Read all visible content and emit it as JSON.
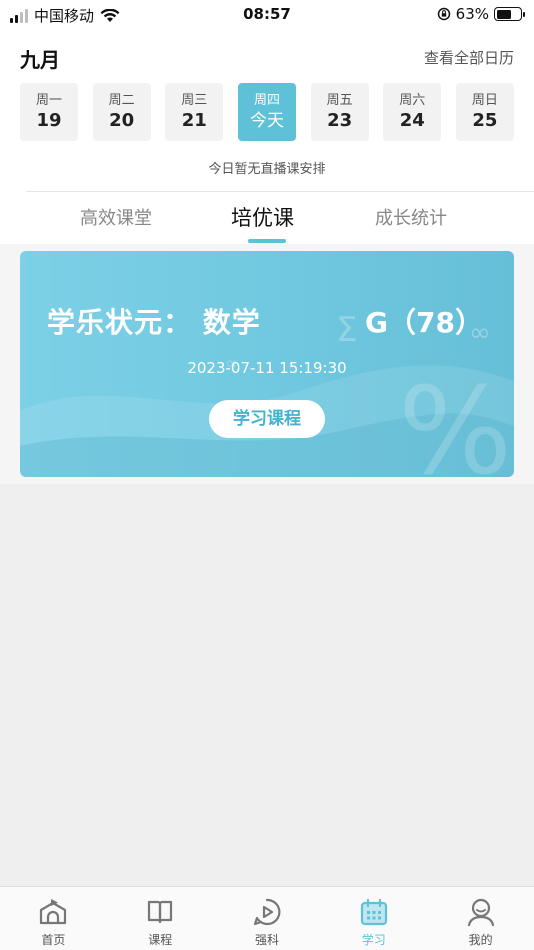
{
  "status_bar": {
    "carrier": "中国移动",
    "time": "08:57",
    "battery": "63%",
    "battery_level": 0.63
  },
  "header": {
    "month": "九月",
    "view_all_calendar": "查看全部日历"
  },
  "week": [
    {
      "weekday": "周一",
      "date": "19"
    },
    {
      "weekday": "周二",
      "date": "20"
    },
    {
      "weekday": "周三",
      "date": "21"
    },
    {
      "weekday": "周四",
      "date": "今天"
    },
    {
      "weekday": "周五",
      "date": "23"
    },
    {
      "weekday": "周六",
      "date": "24"
    },
    {
      "weekday": "周日",
      "date": "25"
    }
  ],
  "selected_day_index": 3,
  "no_live_text": "今日暂无直播课安排",
  "tabs": [
    "高效课堂",
    "培优课",
    "成长统计"
  ],
  "active_tab_index": 1,
  "course_card": {
    "title": "学乐状元： 数学",
    "grade": "G（78）",
    "datetime": "2023-07-11 15:19:30",
    "button": "学习课程"
  },
  "bottom_nav": [
    {
      "label": "首页",
      "icon": "home-icon"
    },
    {
      "label": "课程",
      "icon": "book-icon"
    },
    {
      "label": "强科",
      "icon": "play-circle-icon"
    },
    {
      "label": "学习",
      "icon": "calendar-icon"
    },
    {
      "label": "我的",
      "icon": "user-icon"
    }
  ],
  "active_nav_index": 3,
  "colors": {
    "accent": "#5fc1d7",
    "card_bg": "#70c9e0",
    "background": "#efefef"
  }
}
